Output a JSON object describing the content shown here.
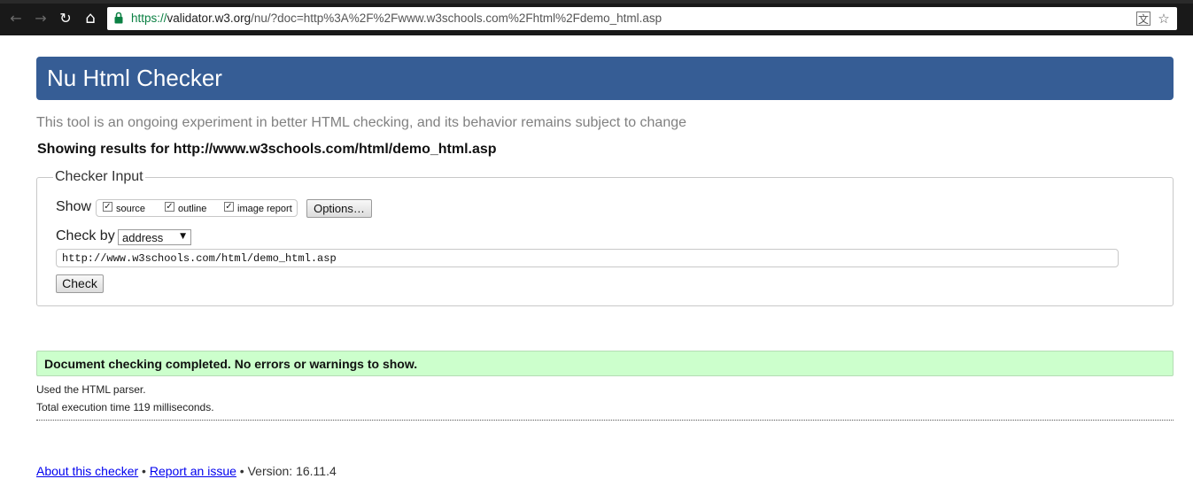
{
  "browser": {
    "url_scheme": "https://",
    "url_host": "validator.w3.org",
    "url_path": "/nu/?doc=http%3A%2F%2Fwww.w3schools.com%2Fhtml%2Fdemo_html.asp",
    "back_icon": "←",
    "forward_icon": "→",
    "reload_icon": "↻",
    "home_icon": "⌂",
    "translate_icon": "文",
    "star_icon": "☆"
  },
  "header": {
    "title": "Nu Html Checker"
  },
  "intro": "This tool is an ongoing experiment in better HTML checking, and its behavior remains subject to change",
  "showing": "Showing results for http://www.w3schools.com/html/demo_html.asp",
  "checker": {
    "legend": "Checker Input",
    "show_label": "Show",
    "show_options": [
      {
        "label": "source",
        "checked": true
      },
      {
        "label": "outline",
        "checked": true
      },
      {
        "label": "image report",
        "checked": true
      }
    ],
    "options_button": "Options…",
    "check_by_label": "Check by",
    "check_by_value": "address",
    "url_value": "http://www.w3schools.com/html/demo_html.asp",
    "check_button": "Check"
  },
  "result": {
    "message": "Document checking completed. No errors or warnings to show.",
    "parser_note": "Used the HTML parser.",
    "time_note": "Total execution time 119 milliseconds."
  },
  "footer": {
    "about_link": "About this checker",
    "sep1": " • ",
    "report_link": "Report an issue",
    "version_text": " • Version: 16.11.4"
  },
  "colors": {
    "banner": "#365d95",
    "success_bg": "#ccffcc",
    "link": "#0000ee"
  }
}
